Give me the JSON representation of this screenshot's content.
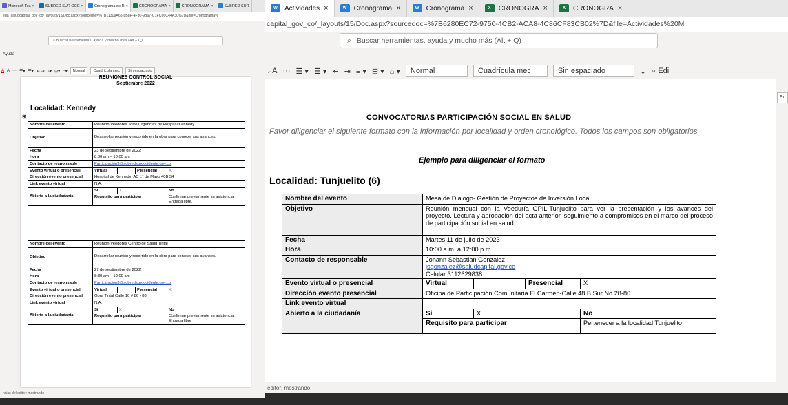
{
  "left": {
    "tabs": [
      {
        "label": "Microsoft Tea",
        "color": "#5b5fc7"
      },
      {
        "label": "SUBRED SUR OCC",
        "color": "#0f6cbd"
      },
      {
        "label": "Cronograma de R",
        "color": "#2b7cd3",
        "active": true
      },
      {
        "label": "CRONOGRAMA",
        "color": "#1e7145"
      },
      {
        "label": "CRONOGRAMA",
        "color": "#1e7145"
      },
      {
        "label": "SUBRED SUR",
        "color": "#2b7cd3"
      }
    ],
    "url": "eda_saludcapital_gov_co/_layouts/15/Doc.aspx?sourcedoc=%7B11309A65-8B8F-4F30-9B67-C1FC66C44A30%7D&file=Cronograma%",
    "search_placeholder": "Buscar herramientas, ayuda y mucho más (Alt + Q)",
    "ayuda": "Ayuda",
    "ribbon": {
      "style_normal": "Normal",
      "style_grid": "Cuadrícula mec",
      "style_nospace": "Sin espaciado"
    },
    "doc": {
      "heading1": "REUNIONES CONTROL SOCIAL",
      "heading2": "Septiembre 2022",
      "locality": "Localidad: Kennedy",
      "event1": {
        "nombre_k": "Nombre del evento",
        "nombre_v": "Reunión Veedores Torre Urgencias de Hospital Kennedy",
        "objetivo_k": "Objetivo",
        "objetivo_v": "Desarrollar reunión y recorrido en la obra para conocer sus avances.",
        "fecha_k": "Fecha",
        "fecha_v": "23 de septiembre de 2022",
        "hora_k": "Hora",
        "hora_v": "8:00 am – 10:00 am",
        "contacto_k": "Contacto de responsable",
        "contacto_v": "Participacion3@subredsuroccidente.gov.co",
        "evento_k": "Evento virtual o presencial",
        "virtual": "Virtual",
        "presencial": "Presencial",
        "mark": "X",
        "direccion_k": "Dirección evento presencial",
        "direccion_v": "Hospital de Kennedy: AC 1° de Mayo 40B 54",
        "link_k": "Link evento virtual",
        "link_v": "N.A.",
        "abierto_k": "Abierto a la ciudadanía",
        "si": "Si",
        "si_mark": "X",
        "no": "No",
        "requisito": "Requisito para participar",
        "requisito_v": "Confirmar previamente su asistencia. Entrada libre."
      },
      "event2": {
        "nombre_k": "Nombre del evento",
        "nombre_v": "Reunión Veedores Centro de Salud Tintal",
        "objetivo_k": "Objetivo",
        "objetivo_v": "Desarrollar reunión y recorrido en la obra para conocer sus avances.",
        "fecha_k": "Fecha",
        "fecha_v": "27 de septiembre de 2022",
        "hora_k": "Hora",
        "hora_v": "8:30 am – 10:00 am",
        "contacto_k": "Contacto de responsable",
        "contacto_v": "Participacion3@subredsuroccidente.gov.co",
        "evento_k": "Evento virtual o presencial",
        "virtual": "Virtual",
        "presencial": "Presencial",
        "mark": "X",
        "direccion_k": "Dirección evento presencial",
        "direccion_v": "Obra Tintal Calle 10 # 86 - 88",
        "link_k": "Link evento virtual",
        "link_v": "N.A.",
        "abierto_k": "Abierto a la ciudadanía",
        "si": "Si",
        "si_mark": "X",
        "no": "No",
        "requisito": "Requisito para participar",
        "requisito_v": "Confirmar previamente su asistencia. Entrada libre"
      }
    },
    "status": "ncias del editor: mostrando"
  },
  "right": {
    "tabs": [
      {
        "label": "Actividades",
        "icon": "W",
        "color": "#2b7cd3",
        "active": true
      },
      {
        "label": "Cronograma",
        "icon": "W",
        "color": "#2b7cd3"
      },
      {
        "label": "Cronograma",
        "icon": "W",
        "color": "#2b7cd3"
      },
      {
        "label": "CRONOGRA",
        "icon": "X",
        "color": "#1e7145"
      },
      {
        "label": "CRONOGRA",
        "icon": "X",
        "color": "#1e7145"
      }
    ],
    "url": "capital_gov_co/_layouts/15/Doc.aspx?sourcedoc=%7B6280EC72-9750-4CB2-ACA8-4C86CF83CB02%7D&file=Actividades%20M",
    "search_placeholder": "Buscar herramientas, ayuda y mucho más (Alt + Q)",
    "ribbon": {
      "style_normal": "Normal",
      "style_grid": "Cuadrícula mec",
      "style_nospace": "Sin espaciado",
      "edit": "Edi"
    },
    "doc": {
      "title": "CONVOCATORIAS PARTICIPACIÓN SOCIAL EN SALUD",
      "instructions": "Favor diligenciar el siguiente formato con la información por localidad y orden cronológico. Todos los campos son obligatorios",
      "example": "Ejemplo para diligenciar el formato",
      "locality": "Localidad: Tunjuelito (6)",
      "event": {
        "nombre_k": "Nombre del evento",
        "nombre_v": "Mesa de Dialogo- Gestión de Proyectos de Inversión Local",
        "objetivo_k": "Objetivo",
        "objetivo_v": "Reunión mensual con la Veeduría GPIL-Tunjuelito para ver la presentación y los avances del proyecto. Lectura y aprobación del acta anterior, seguimiento a compromisos en el marco del proceso de participación social en salud.",
        "fecha_k": "Fecha",
        "fecha_v": "Martes 11 de julio de 2023",
        "hora_k": "Hora",
        "hora_v": "10:00 a.m. a 12:00 p.m.",
        "contacto_k": "Contacto de responsable",
        "contacto_name": "Johann Sebastian Gonzalez",
        "contacto_email": "jsgonzalez@saludcapital.gov.co",
        "contacto_phone": "Celular 3112629838",
        "evento_k": "Evento virtual o presencial",
        "virtual": "Virtual",
        "presencial": "Presencial",
        "mark": "X",
        "direccion_k": "Dirección evento presencial",
        "direccion_v": "Oficina de Participación Comunitaria El Carmen-Calle 48 B Sur No 28-80",
        "link_k": "Link evento virtual",
        "abierto_k": "Abierto a la ciudadanía",
        "si": "Si",
        "si_mark": "X",
        "no": "No",
        "requisito": "Requisito para participar",
        "requisito_v": "Pertenecer a la localidad Tunjuelito"
      }
    },
    "edge_button": "Ec",
    "status": "editor: mostrando"
  }
}
